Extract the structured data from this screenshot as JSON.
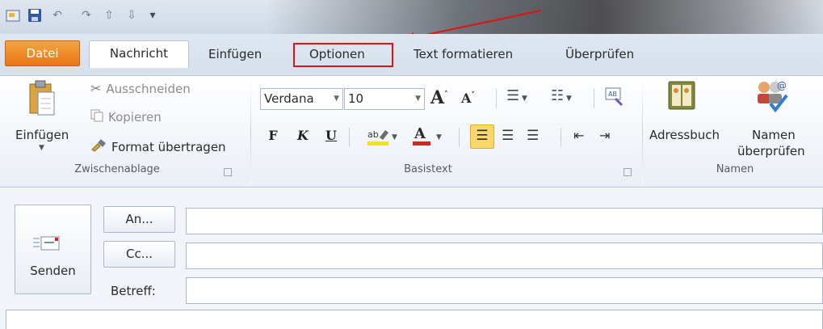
{
  "quick_access": {
    "icons": [
      "app-icon",
      "save-icon",
      "undo-icon",
      "redo-icon",
      "up-arrow-icon",
      "down-arrow-icon",
      "customize-icon"
    ]
  },
  "tabs": [
    {
      "label": "Datei"
    },
    {
      "label": "Nachricht"
    },
    {
      "label": "Einfügen"
    },
    {
      "label": "Optionen"
    },
    {
      "label": "Text formatieren"
    },
    {
      "label": "Überprüfen"
    }
  ],
  "ribbon": {
    "clipboard": {
      "paste_label": "Einfügen",
      "cut_label": "Ausschneiden",
      "copy_label": "Kopieren",
      "format_painter_label": "Format übertragen",
      "group_label": "Zwischenablage"
    },
    "basic_text": {
      "font": "Verdana",
      "size": "10",
      "bold": "F",
      "italic": "K",
      "underline": "U",
      "group_label": "Basistext"
    },
    "names": {
      "address_book_label": "Adressbuch",
      "check_names_label_1": "Namen",
      "check_names_label_2": "überprüfen",
      "group_label": "Namen"
    }
  },
  "compose": {
    "send_label": "Senden",
    "to_label": "An...",
    "cc_label": "Cc...",
    "subject_label": "Betreff:",
    "to_value": "",
    "cc_value": "",
    "subject_value": ""
  },
  "colors": {
    "file_tab": "#f08a24",
    "highlight_box": "#e01212",
    "ribbon_bg": "#e9eff6"
  }
}
